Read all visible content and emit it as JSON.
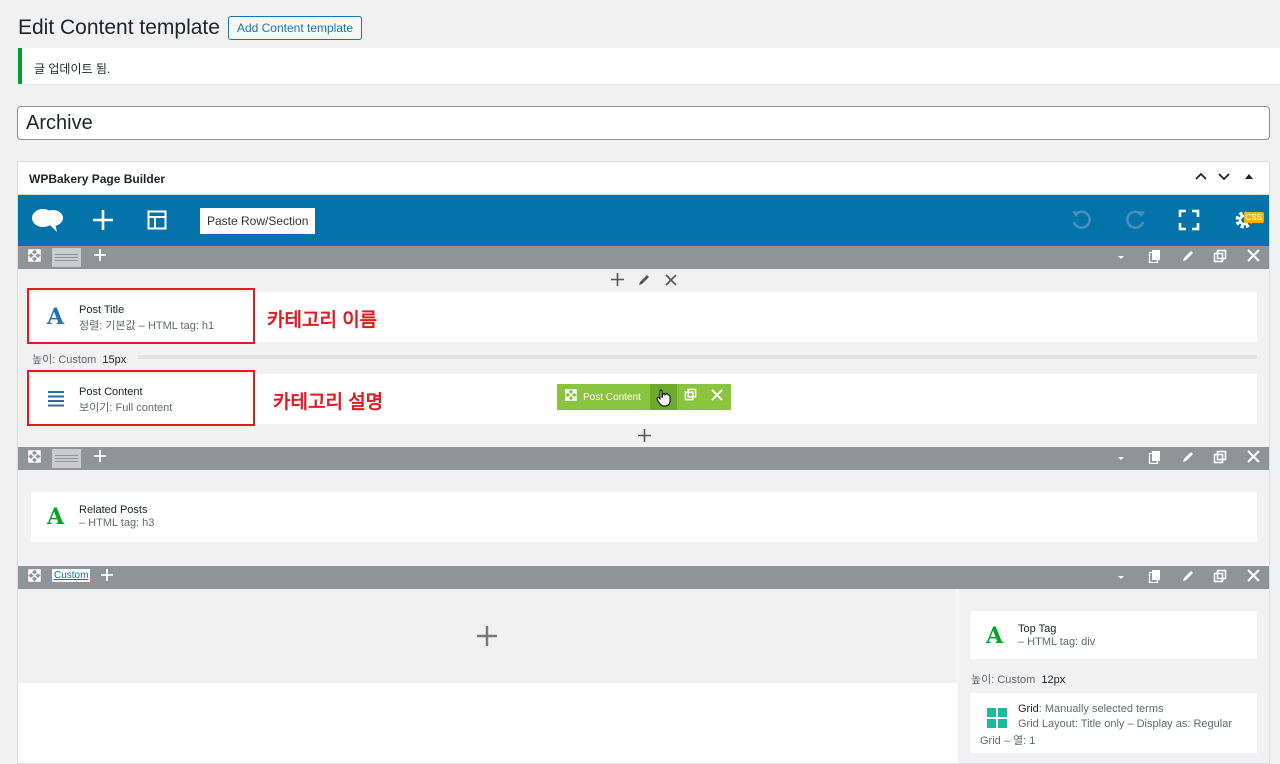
{
  "page": {
    "title": "Edit Content template",
    "add_label": "Add Content template"
  },
  "notice": {
    "text": "글 업데이트 됨."
  },
  "post_title": {
    "value": "Archive"
  },
  "wpb": {
    "title": "WPBakery Page Builder",
    "paste_label": "Paste Row/Section",
    "css_badge": "CSS"
  },
  "row1": {
    "elements": [
      {
        "name": "Post Title",
        "sub": "정렬: 기본값  – HTML tag: h1",
        "icon": "text-a-icon"
      },
      {
        "name": "Post Content",
        "sub": "보이기: Full content",
        "icon": "paragraph-lines-icon"
      }
    ],
    "spacer": {
      "label": "높이: Custom",
      "value": "15px"
    },
    "annotations": [
      "카테고리 이름",
      "카테고리 설명"
    ],
    "hover_toolbar": {
      "label": "Post Content"
    }
  },
  "row2": {
    "elements": [
      {
        "name": "Related Posts",
        "sub": "– HTML tag: h3",
        "icon": "text-a-icon"
      }
    ]
  },
  "row3": {
    "tag": "Custom",
    "elements": [
      {
        "name": "Top Tag",
        "sub": "– HTML tag: div",
        "icon": "text-a-icon"
      }
    ],
    "spacer": {
      "label": "높이: Custom",
      "value": "12px"
    },
    "grid": {
      "name": "Grid",
      "name_suffix": ": Manually selected terms",
      "sub1": "Grid Layout: Title only  –  Display as: Regular",
      "sub2": "Grid  –  열: 1"
    }
  },
  "colors": {
    "accent": "#0473aa",
    "success": "#00a32a",
    "annotation": "#e01b24",
    "element_toolbar": "#8ac43f"
  }
}
